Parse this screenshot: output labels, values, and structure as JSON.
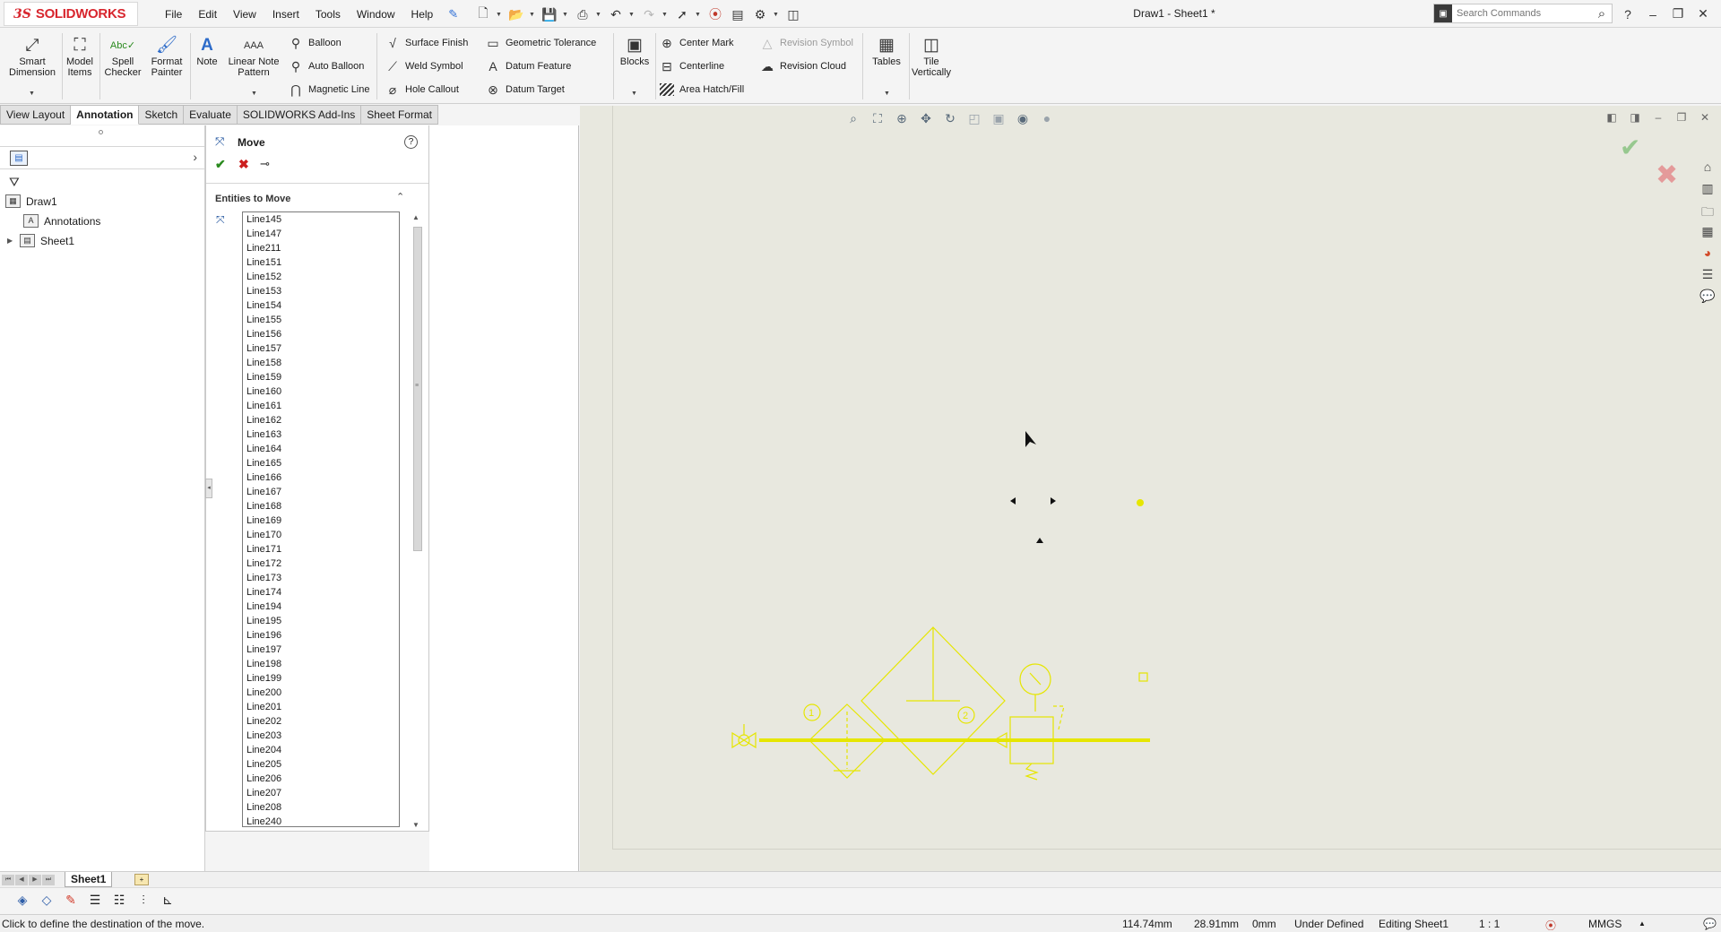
{
  "app": {
    "logo_prefix": "3S",
    "logo_brand": "SOLIDWORKS",
    "doc_title": "Draw1 - Sheet1 *"
  },
  "menu": [
    "File",
    "Edit",
    "View",
    "Insert",
    "Tools",
    "Window",
    "Help"
  ],
  "search": {
    "placeholder": "Search Commands"
  },
  "command_manager": {
    "smart_dimension": "Smart Dimension",
    "model_items": "Model Items",
    "spell_checker": "Spell Checker",
    "format_painter": "Format Painter",
    "note": "Note",
    "linear_note_pattern": "Linear Note Pattern",
    "balloon": "Balloon",
    "auto_balloon": "Auto Balloon",
    "magnetic_line": "Magnetic Line",
    "surface_finish": "Surface Finish",
    "weld_symbol": "Weld Symbol",
    "hole_callout": "Hole Callout",
    "geometric_tolerance": "Geometric Tolerance",
    "datum_feature": "Datum Feature",
    "datum_target": "Datum Target",
    "blocks": "Blocks",
    "center_mark": "Center Mark",
    "centerline": "Centerline",
    "area_hatch_fill": "Area Hatch/Fill",
    "revision_symbol": "Revision Symbol",
    "revision_cloud": "Revision Cloud",
    "tables": "Tables",
    "tile_vertically": "Tile Vertically"
  },
  "tabs": [
    {
      "label": "View Layout",
      "active": false
    },
    {
      "label": "Annotation",
      "active": true
    },
    {
      "label": "Sketch",
      "active": false
    },
    {
      "label": "Evaluate",
      "active": false
    },
    {
      "label": "SOLIDWORKS Add-Ins",
      "active": false
    },
    {
      "label": "Sheet Format",
      "active": false
    }
  ],
  "tree": {
    "root": "Draw1",
    "annotations": "Annotations",
    "sheet": "Sheet1"
  },
  "move_panel": {
    "title": "Move",
    "section_title": "Entities to Move",
    "entities": [
      "Line145",
      "Line147",
      "Line211",
      "Line151",
      "Line152",
      "Line153",
      "Line154",
      "Line155",
      "Line156",
      "Line157",
      "Line158",
      "Line159",
      "Line160",
      "Line161",
      "Line162",
      "Line163",
      "Line164",
      "Line165",
      "Line166",
      "Line167",
      "Line168",
      "Line169",
      "Line170",
      "Line171",
      "Line172",
      "Line173",
      "Line174",
      "Line194",
      "Line195",
      "Line196",
      "Line197",
      "Line198",
      "Line199",
      "Line200",
      "Line201",
      "Line202",
      "Line203",
      "Line204",
      "Line205",
      "Line206",
      "Line207",
      "Line208",
      "Line240"
    ]
  },
  "drawing": {
    "color": "#e6e600",
    "balloon_1": "1",
    "balloon_2": "2"
  },
  "sheet_tabs": {
    "active": "Sheet1"
  },
  "status": {
    "message": "Click to define the destination of the move.",
    "x": "114.74mm",
    "y": "28.91mm",
    "z": "0mm",
    "definition": "Under Defined",
    "editing": "Editing Sheet1",
    "scale": "1 : 1",
    "units": "MMGS"
  }
}
